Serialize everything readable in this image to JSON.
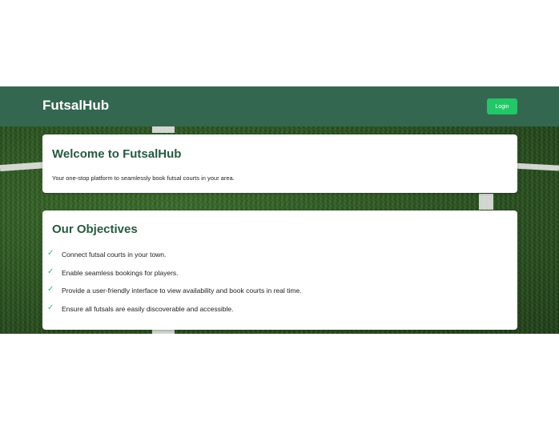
{
  "header": {
    "brand": "FutsalHub",
    "login_label": "Login"
  },
  "welcome": {
    "title": "Welcome to FutsalHub",
    "description": "Your one-stop platform to seamlessly book futsal courts in your area."
  },
  "objectives": {
    "title": "Our Objectives",
    "check_icon": "✓",
    "items": [
      "Connect futsal courts in your town.",
      "Enable seamless bookings for players.",
      "Provide a user-friendly interface to view availability and book courts in real time.",
      "Ensure all futsals are easily discoverable and accessible."
    ]
  },
  "colors": {
    "header_bg": "#346750",
    "accent": "#22c767",
    "heading": "#265a3f"
  }
}
